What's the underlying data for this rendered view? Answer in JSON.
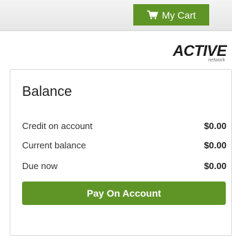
{
  "header": {
    "cart_label": "My Cart",
    "cart_icon": "shopping-cart-icon",
    "cart_color": "#5f9526"
  },
  "logo": {
    "wordmark": "ACTIVE",
    "subtext": "network"
  },
  "balance": {
    "title": "Balance",
    "rows": [
      {
        "label": "Credit on account",
        "value": "$0.00"
      },
      {
        "label": "Current balance",
        "value": "$0.00"
      },
      {
        "label": "Due now",
        "value": "$0.00"
      }
    ],
    "pay_label": "Pay On Account",
    "pay_color": "#5f9526"
  }
}
